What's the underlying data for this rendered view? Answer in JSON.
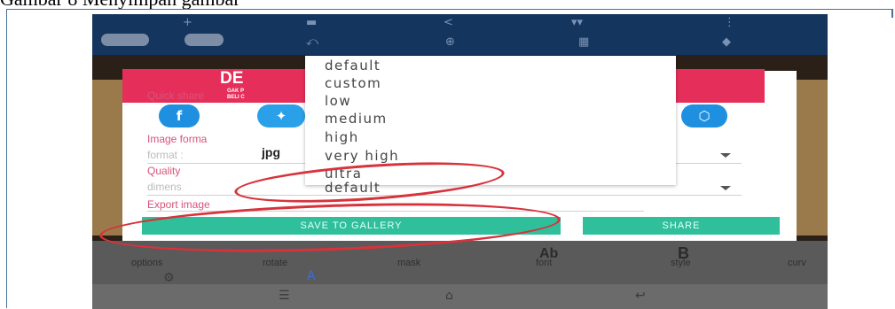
{
  "caption": "Gambar 8 Menyimpan gambar",
  "toolbar": {
    "icons": [
      "plus-icon",
      "save-icon",
      "share-icon",
      "crop-icon",
      "menu-icon",
      "brush-icon",
      "eraser-icon",
      "undo-icon",
      "zoom-icon",
      "grid-icon",
      "layers-icon"
    ]
  },
  "dialog": {
    "banner_text": "DE",
    "banner_sub1": "GAK P",
    "banner_sub2": "BELI C",
    "quick_share_label": "Quick share",
    "share_icons": [
      "f",
      "t",
      "dropbox"
    ],
    "image_format_label": "Image forma",
    "format_label": "format :",
    "format_value": "jpg",
    "quality_label": "Quality",
    "dimension_label": "dimens",
    "export_label": "Export image",
    "save_button": "SAVE TO GALLERY",
    "share_button": "SHARE"
  },
  "dropdown": {
    "options": [
      "default",
      "custom",
      "low",
      "medium",
      "high",
      "very high",
      "ultra",
      "default"
    ]
  },
  "bottom_tools": {
    "labels": [
      "options",
      "rotate",
      "mask",
      "font",
      "style",
      "curv"
    ],
    "icons": [
      "Ab",
      "B"
    ]
  },
  "colors": {
    "toolbar": "#14365e",
    "accent": "#2fbf9b",
    "annotation": "#d8323c",
    "label": "#d9527a"
  }
}
